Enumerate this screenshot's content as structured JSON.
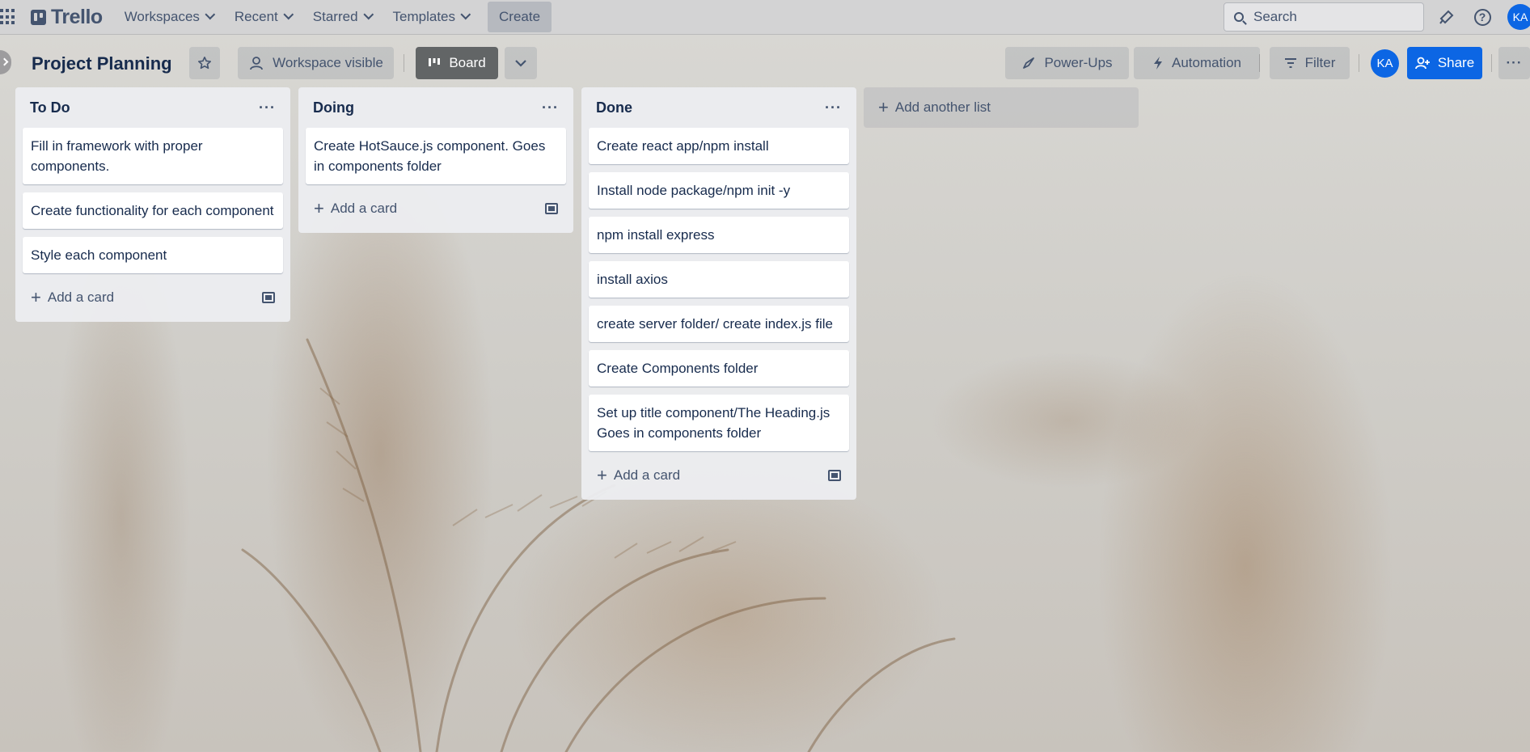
{
  "topnav": {
    "brand": "Trello",
    "menu": [
      {
        "label": "Workspaces"
      },
      {
        "label": "Recent"
      },
      {
        "label": "Starred"
      },
      {
        "label": "Templates"
      }
    ],
    "create_label": "Create",
    "search_placeholder": "Search",
    "avatar_initials": "KA"
  },
  "board": {
    "title": "Project Planning",
    "visibility_label": "Workspace visible",
    "view_label": "Board",
    "powerups_label": "Power-Ups",
    "automation_label": "Automation",
    "filter_label": "Filter",
    "member_initials": "KA",
    "share_label": "Share",
    "more_label": "···"
  },
  "lists": [
    {
      "title": "To Do",
      "cards": [
        "Fill in framework with proper components.",
        "Create functionality for each component",
        "Style each component"
      ],
      "add_card": "Add a card"
    },
    {
      "title": "Doing",
      "cards": [
        "Create HotSauce.js component. Goes in components folder"
      ],
      "add_card": "Add a card"
    },
    {
      "title": "Done",
      "cards": [
        "Create react app/npm install",
        "Install node package/npm init -y",
        "npm install express",
        "install axios",
        "create server folder/ create index.js file",
        "Create Components folder",
        "Set up title component/The Heading.js Goes in components folder"
      ],
      "add_card": "Add a card"
    }
  ],
  "add_list_label": "Add another list",
  "list_menu_label": "···"
}
